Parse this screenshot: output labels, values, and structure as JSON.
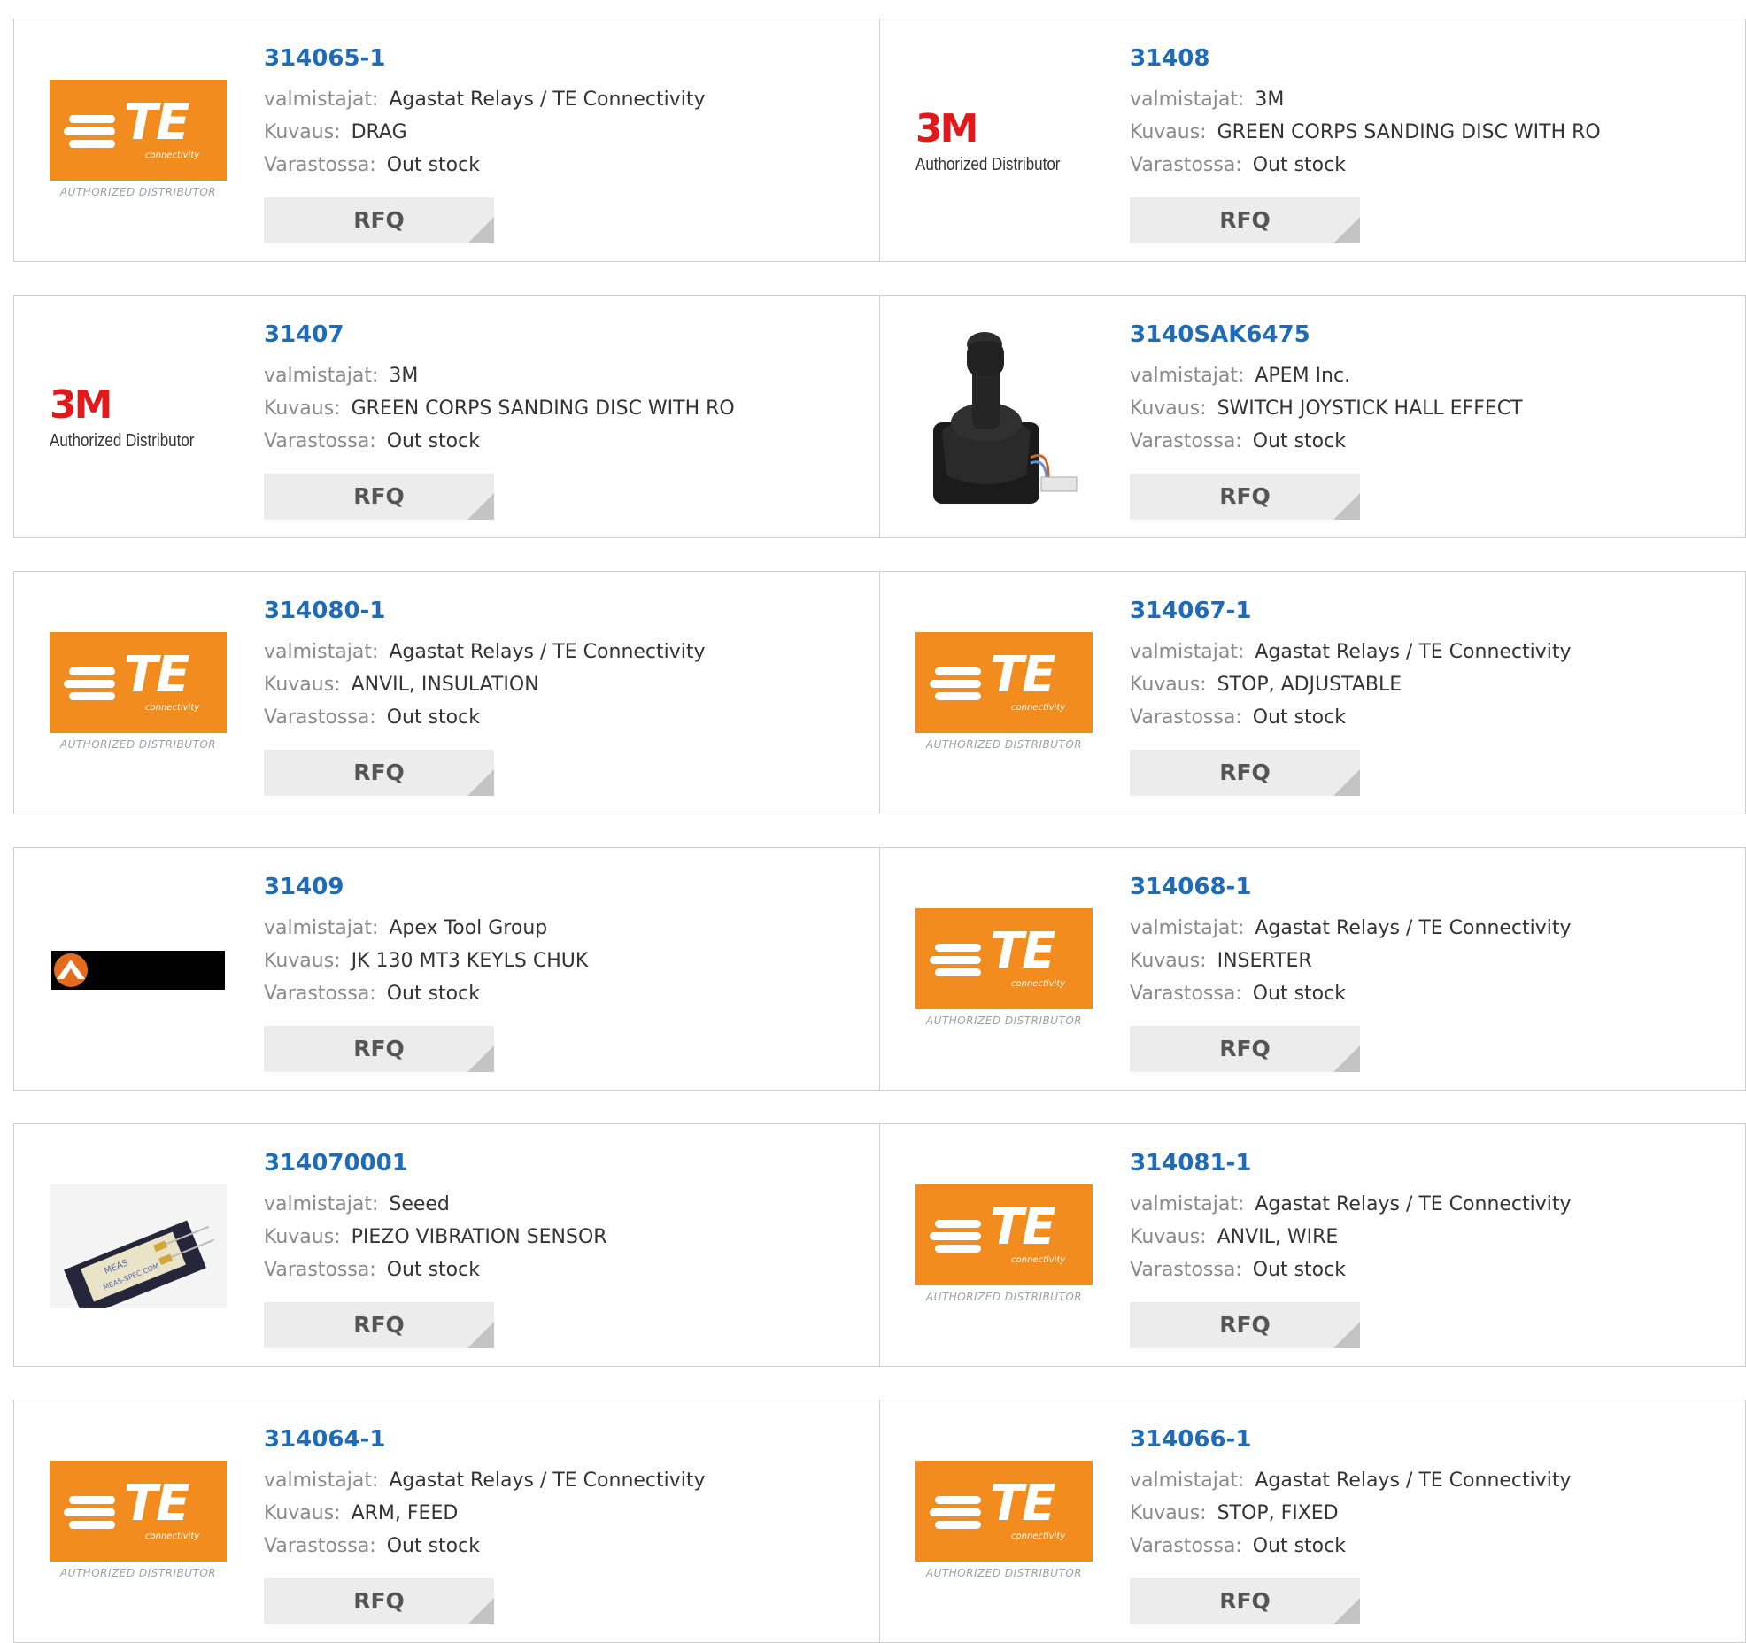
{
  "labels": {
    "manufacturer": "valmistajat:",
    "description": "Kuvaus:",
    "stock": "Varastossa:",
    "rfq": "RFQ"
  },
  "logo_text": {
    "te_word": "TE",
    "te_connectivity": "connectivity",
    "te_authorized": "AUTHORIZED DISTRIBUTOR",
    "m3_mark": "3M",
    "m3_authorized": "Authorized Distributor"
  },
  "colors": {
    "part_link": "#1e6bb8",
    "te_orange": "#f28c1f",
    "m3_red": "#e0191c",
    "rfq_bg": "#ececec",
    "border": "#cfcfcf"
  },
  "products": [
    {
      "part": "314065-1",
      "manufacturer": "Agastat Relays / TE Connectivity",
      "description": "DRAG",
      "stock": "Out stock",
      "image": "te-logo"
    },
    {
      "part": "31408",
      "manufacturer": "3M",
      "description": "GREEN CORPS SANDING DISC WITH RO",
      "stock": "Out stock",
      "image": "3m-logo"
    },
    {
      "part": "31407",
      "manufacturer": "3M",
      "description": "GREEN CORPS SANDING DISC WITH RO",
      "stock": "Out stock",
      "image": "3m-logo"
    },
    {
      "part": "3140SAK6475",
      "manufacturer": "APEM Inc.",
      "description": "SWITCH JOYSTICK HALL EFFECT",
      "stock": "Out stock",
      "image": "joystick-photo"
    },
    {
      "part": "314080-1",
      "manufacturer": "Agastat Relays / TE Connectivity",
      "description": "ANVIL, INSULATION",
      "stock": "Out stock",
      "image": "te-logo"
    },
    {
      "part": "314067-1",
      "manufacturer": "Agastat Relays / TE Connectivity",
      "description": "STOP, ADJUSTABLE",
      "stock": "Out stock",
      "image": "te-logo"
    },
    {
      "part": "31409",
      "manufacturer": "Apex Tool Group",
      "description": "JK 130 MT3 KEYLS CHUK",
      "stock": "Out stock",
      "image": "apex-logo"
    },
    {
      "part": "314068-1",
      "manufacturer": "Agastat Relays / TE Connectivity",
      "description": "INSERTER",
      "stock": "Out stock",
      "image": "te-logo"
    },
    {
      "part": "314070001",
      "manufacturer": "Seeed",
      "description": "PIEZO VIBRATION SENSOR",
      "stock": "Out stock",
      "image": "sensor-photo",
      "image_text": [
        "MEAS",
        "MEAS-SPEC.COM"
      ]
    },
    {
      "part": "314081-1",
      "manufacturer": "Agastat Relays / TE Connectivity",
      "description": "ANVIL, WIRE",
      "stock": "Out stock",
      "image": "te-logo"
    },
    {
      "part": "314064-1",
      "manufacturer": "Agastat Relays / TE Connectivity",
      "description": "ARM, FEED",
      "stock": "Out stock",
      "image": "te-logo"
    },
    {
      "part": "314066-1",
      "manufacturer": "Agastat Relays / TE Connectivity",
      "description": "STOP, FIXED",
      "stock": "Out stock",
      "image": "te-logo"
    }
  ]
}
